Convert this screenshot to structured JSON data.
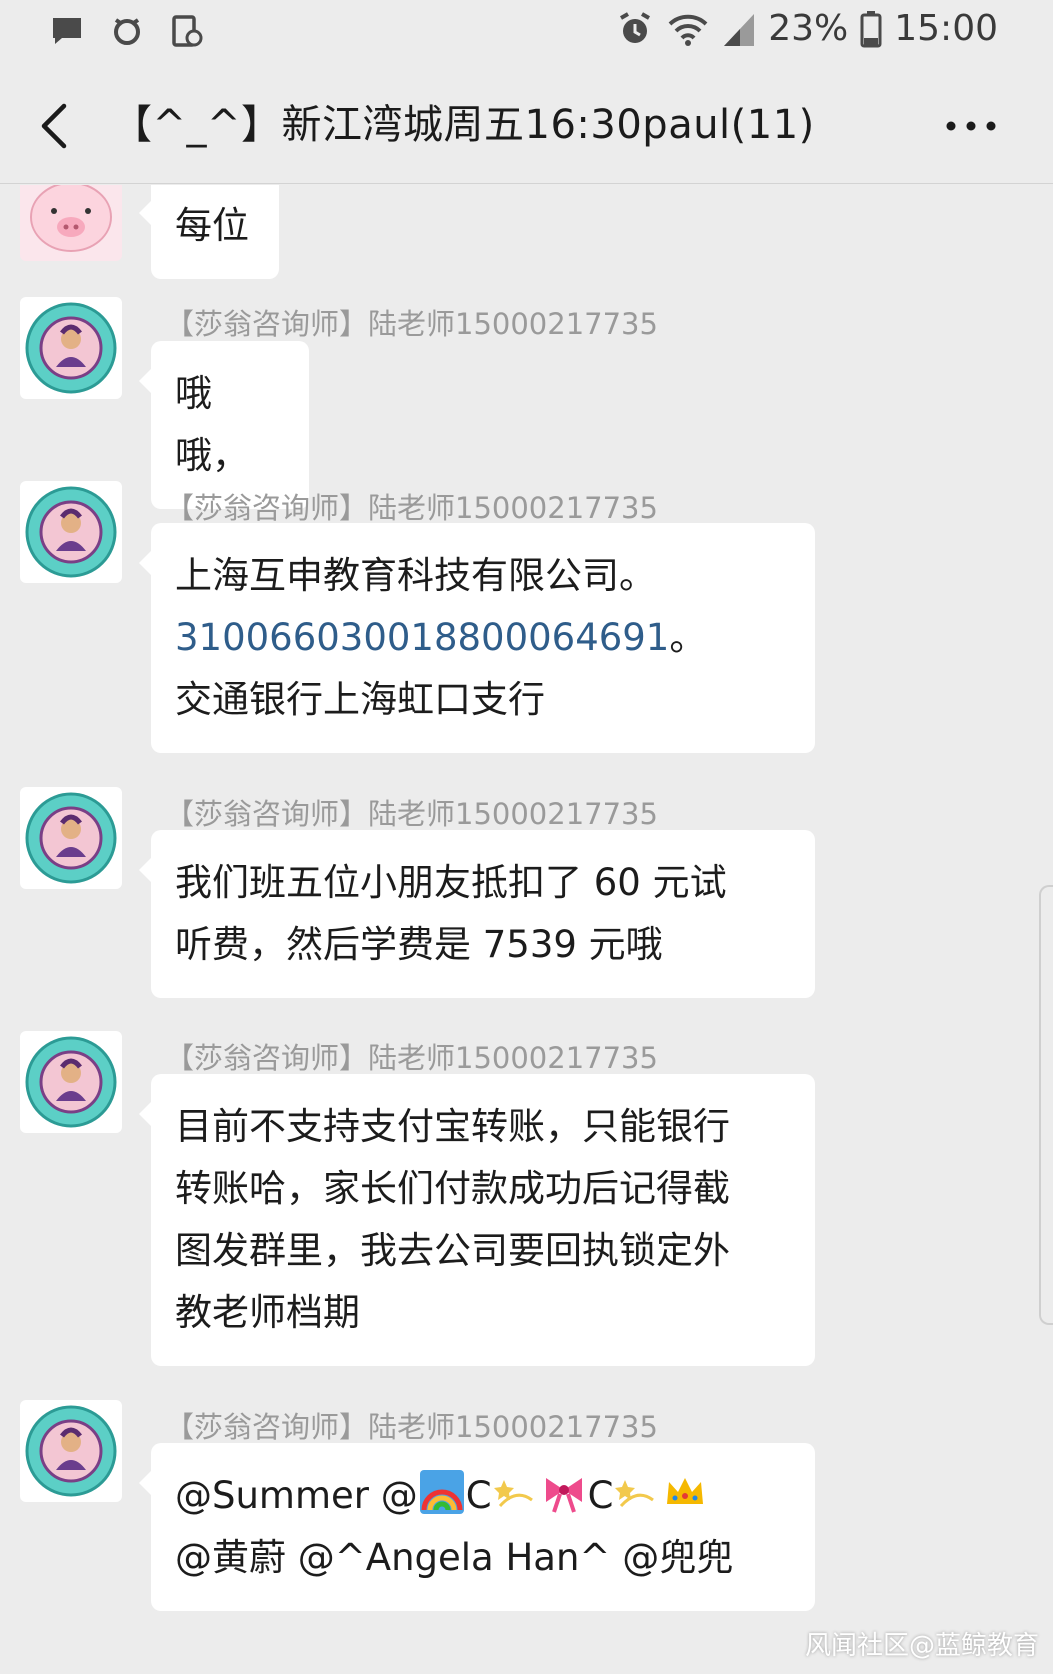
{
  "status_bar": {
    "battery_percent": "23%",
    "time": "15:00",
    "left_icons": [
      "message-notification-icon",
      "alarm-notification-icon",
      "screen-notification-icon"
    ],
    "right_icons": [
      "alarm-icon",
      "wifi-icon",
      "signal-icon",
      "battery-icon"
    ]
  },
  "header": {
    "title": "【^_^】新江湾城周五16:30paul(11)",
    "back_icon": "chevron-left-icon",
    "more_icon": "more-dots-icon"
  },
  "messages": [
    {
      "sender": "",
      "text": "每位",
      "avatar": "pig-avatar"
    },
    {
      "sender": "【莎翁咨询师】陆老师15000217735",
      "text": "哦哦，",
      "avatar": "school-logo-avatar"
    },
    {
      "sender": "【莎翁咨询师】陆老师15000217735",
      "line1": "上海互申教育科技有限公司。",
      "account_number": "310066030018800064691",
      "line2_suffix": "。",
      "line3": "交通银行上海虹口支行",
      "avatar": "school-logo-avatar"
    },
    {
      "sender": "【莎翁咨询师】陆老师15000217735",
      "line1": "我们班五位小朋友抵扣了 60 元试",
      "line2": "听费，然后学费是 7539 元哦",
      "avatar": "school-logo-avatar"
    },
    {
      "sender": "【莎翁咨询师】陆老师15000217735",
      "line1": "目前不支持支付宝转账，只能银行",
      "line2": "转账哈，家长们付款成功后记得截",
      "line3": "图发群里，我去公司要回执锁定外",
      "line4": "教老师档期",
      "avatar": "school-logo-avatar"
    },
    {
      "sender": "【莎翁咨询师】陆老师15000217735",
      "mention1": "@Summer",
      "mention2_prefix": "@",
      "mention2_c1": "C",
      "mention2_c2": "C",
      "line2": "@黄蔚  @^Angela Han^ @兜兜",
      "emojis": [
        "rainbow-emoji",
        "dizzy-emoji",
        "ribbon-emoji",
        "dizzy-emoji",
        "crown-emoji"
      ],
      "avatar": "school-logo-avatar"
    }
  ],
  "watermark": "风闻社区@蓝鲸教育",
  "colors": {
    "background": "#ececec",
    "bubble": "#ffffff",
    "sender_text": "#9a9a9a",
    "link": "#2f5d8a"
  }
}
